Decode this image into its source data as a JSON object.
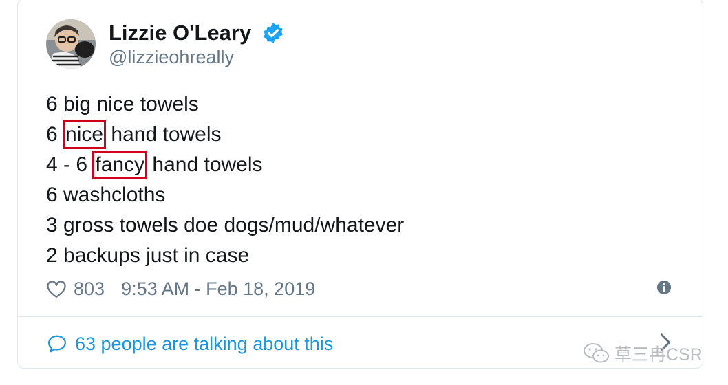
{
  "tweet": {
    "author_name": "Lizzie O'Leary",
    "author_handle": "@lizzieohreally",
    "lines": [
      {
        "before": "6 big nice towels",
        "highlight": "",
        "after": ""
      },
      {
        "before": "6 ",
        "highlight": "nice",
        "after": " hand towels"
      },
      {
        "before": "4 - 6 ",
        "highlight": "fancy",
        "after": " hand towels"
      },
      {
        "before": "6 washcloths",
        "highlight": "",
        "after": ""
      },
      {
        "before": "3 gross towels doe dogs/mud/whatever",
        "highlight": "",
        "after": ""
      },
      {
        "before": "2 backups just in case",
        "highlight": "",
        "after": ""
      }
    ],
    "likes": "803",
    "timestamp": "9:53 AM - Feb 18, 2019",
    "conversation_text": "63 people are talking about this"
  },
  "watermark": {
    "text": "草三冉CSR"
  },
  "icons": {
    "verified": "verified-badge-icon",
    "like": "heart-icon",
    "info": "info-icon",
    "conversation": "speech-bubble-icon",
    "more": "chevron-right-icon",
    "watermark": "wechat-icon"
  },
  "colors": {
    "text": "#14171a",
    "secondary": "#657786",
    "link": "#1b95e0",
    "verified": "#1da1f2",
    "highlight_box": "#d0021b",
    "border": "#e1e8ed"
  }
}
